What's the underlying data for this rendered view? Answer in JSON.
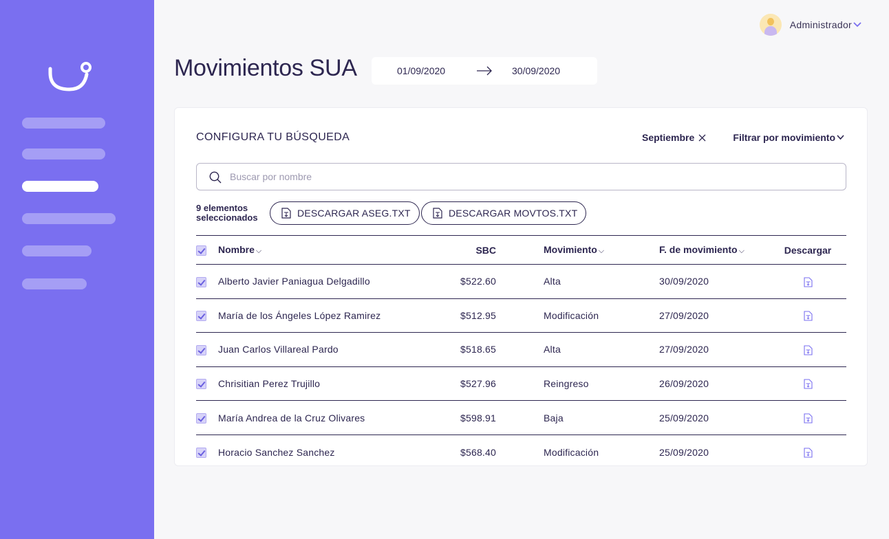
{
  "app": {
    "title": "Movimientos SUA",
    "accent": "#7a6ff0"
  },
  "user": {
    "name": "Administrador",
    "menu_icon": "chevron-down-icon"
  },
  "date_range": {
    "start": "01/09/2020",
    "end": "30/09/2020"
  },
  "search_config": {
    "title": "CONFIGURA TU BÚSQUEDA",
    "month_chip": "Septiembre",
    "movement_filter": "Filtrar por movimiento",
    "search_placeholder": "Buscar por nombre",
    "search_value": ""
  },
  "selection": {
    "count_line1": "9 elementos",
    "count_line2": "seleccionados",
    "download_aseg": "DESCARGAR ASEG.TXT",
    "download_movtos": "DESCARGAR MOVTOS.TXT"
  },
  "table": {
    "headers": {
      "name": "Nombre",
      "sbc": "SBC",
      "movement": "Movimiento",
      "date": "F. de movimiento",
      "download": "Descargar"
    },
    "rows": [
      {
        "name": "Alberto Javier Paniagua Delgadillo",
        "sbc": "$522.60",
        "movement": "Alta",
        "date": "30/09/2020",
        "checked": true
      },
      {
        "name": "María de los Ángeles López Ramirez",
        "sbc": "$512.95",
        "movement": "Modificación",
        "date": "27/09/2020",
        "checked": true
      },
      {
        "name": "Juan Carlos Villareal Pardo",
        "sbc": "$518.65",
        "movement": "Alta",
        "date": "27/09/2020",
        "checked": true
      },
      {
        "name": "Chrisitian Perez Trujillo",
        "sbc": "$527.96",
        "movement": "Reingreso",
        "date": "26/09/2020",
        "checked": true
      },
      {
        "name": "María Andrea de la Cruz Olivares",
        "sbc": "$598.91",
        "movement": "Baja",
        "date": "25/09/2020",
        "checked": true
      },
      {
        "name": "Horacio Sanchez Sanchez",
        "sbc": "$568.40",
        "movement": "Modificación",
        "date": "25/09/2020",
        "checked": true
      }
    ]
  }
}
